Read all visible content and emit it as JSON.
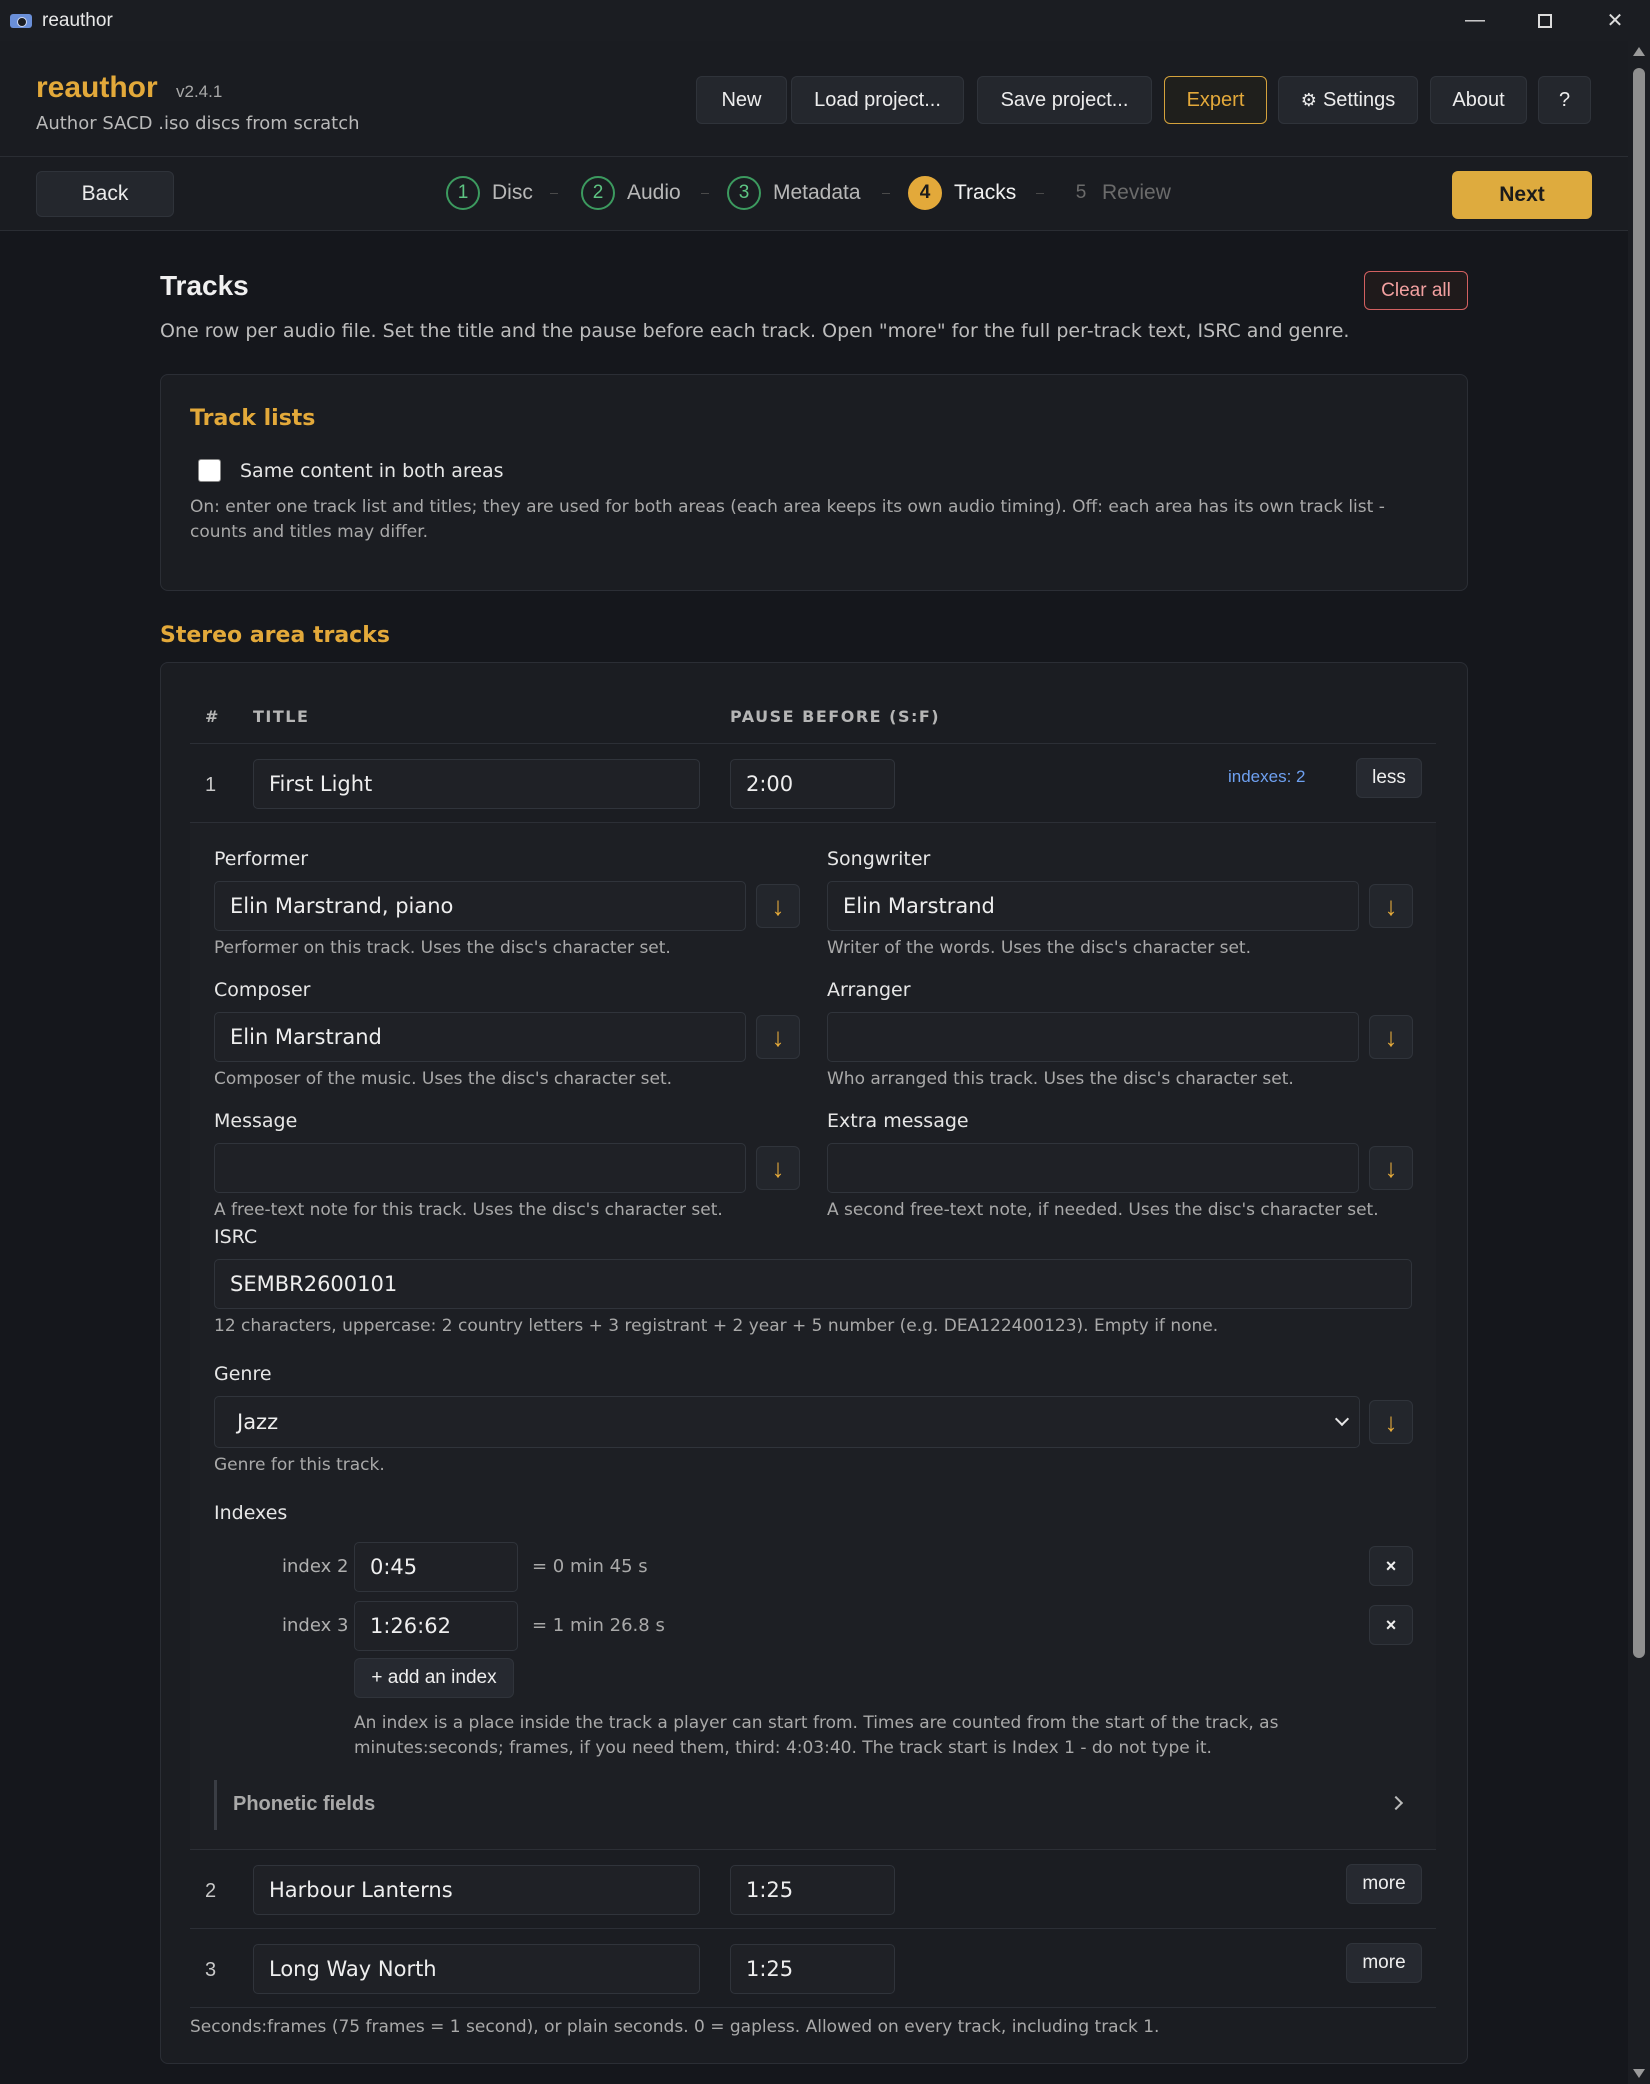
{
  "window": {
    "title": "reauthor",
    "controls": {
      "minimize": "—",
      "close": "✕"
    }
  },
  "header": {
    "brand": "reauthor",
    "version": "v2.4.1",
    "tagline": "Author SACD .iso discs from scratch",
    "buttons": {
      "new": "New",
      "load": "Load project...",
      "save": "Save project...",
      "expert": "Expert",
      "settings": "Settings",
      "settings_icon": "⚙",
      "about": "About",
      "help": "?"
    }
  },
  "stepbar": {
    "back": "Back",
    "next": "Next",
    "steps": [
      {
        "num": "1",
        "label": "Disc",
        "state": "done"
      },
      {
        "num": "2",
        "label": "Audio",
        "state": "done"
      },
      {
        "num": "3",
        "label": "Metadata",
        "state": "done"
      },
      {
        "num": "4",
        "label": "Tracks",
        "state": "active"
      },
      {
        "num": "5",
        "label": "Review",
        "state": "future"
      }
    ]
  },
  "page": {
    "title": "Tracks",
    "description": "One row per audio file. Set the title and the pause before each track. Open \"more\" for the full per-track text, ISRC and genre.",
    "clear_all": "Clear all"
  },
  "track_lists": {
    "heading": "Track lists",
    "same_content_label": "Same content in both areas",
    "same_content_checked": false,
    "hint": "On: enter one track list and titles; they are used for both areas (each area keeps its own audio timing). Off: each area has its own track list - counts and titles may differ."
  },
  "stereo": {
    "heading": "Stereo area tracks",
    "columns": {
      "num": "#",
      "title": "TITLE",
      "pause": "PAUSE BEFORE (S:F)"
    },
    "tracks": [
      {
        "num": "1",
        "title": "First Light",
        "pause": "2:00",
        "indexes_link": "indexes: 2",
        "toggle": "less"
      },
      {
        "num": "2",
        "title": "Harbour Lanterns",
        "pause": "1:25",
        "toggle": "more"
      },
      {
        "num": "3",
        "title": "Long Way North",
        "pause": "1:25",
        "toggle": "more"
      }
    ],
    "footer_hint": "Seconds:frames (75 frames = 1 second), or plain seconds. 0 = gapless. Allowed on every track, including track 1."
  },
  "details": {
    "performer": {
      "label": "Performer",
      "value": "Elin Marstrand, piano",
      "hint": "Performer on this track. Uses the disc's character set."
    },
    "songwriter": {
      "label": "Songwriter",
      "value": "Elin Marstrand",
      "hint": "Writer of the words. Uses the disc's character set."
    },
    "composer": {
      "label": "Composer",
      "value": "Elin Marstrand",
      "hint": "Composer of the music. Uses the disc's character set."
    },
    "arranger": {
      "label": "Arranger",
      "value": "",
      "hint": "Who arranged this track. Uses the disc's character set."
    },
    "message": {
      "label": "Message",
      "value": "",
      "hint": "A free-text note for this track. Uses the disc's character set."
    },
    "extra_message": {
      "label": "Extra message",
      "value": "",
      "hint": "A second free-text note, if needed. Uses the disc's character set."
    },
    "isrc": {
      "label": "ISRC",
      "value": "SEMBR2600101",
      "hint": "12 characters, uppercase: 2 country letters + 3 registrant + 2 year + 5 number (e.g. DEA122400123). Empty if none."
    },
    "genre": {
      "label": "Genre",
      "value": "Jazz",
      "hint": "Genre for this track."
    },
    "copy_down_glyph": "↓",
    "indexes": {
      "label": "Indexes",
      "items": [
        {
          "label": "index 2",
          "value": "0:45",
          "equals": "= 0 min 45 s",
          "remove": "×"
        },
        {
          "label": "index 3",
          "value": "1:26:62",
          "equals": "= 1 min 26.8 s",
          "remove": "×"
        }
      ],
      "add": "+ add an index",
      "hint": "An index is a place inside the track a player can start from. Times are counted from the start of the track, as minutes:seconds; frames, if you need them, third: 4:03:40. The track start is Index 1 - do not type it."
    },
    "phonetic": "Phonetic fields"
  }
}
